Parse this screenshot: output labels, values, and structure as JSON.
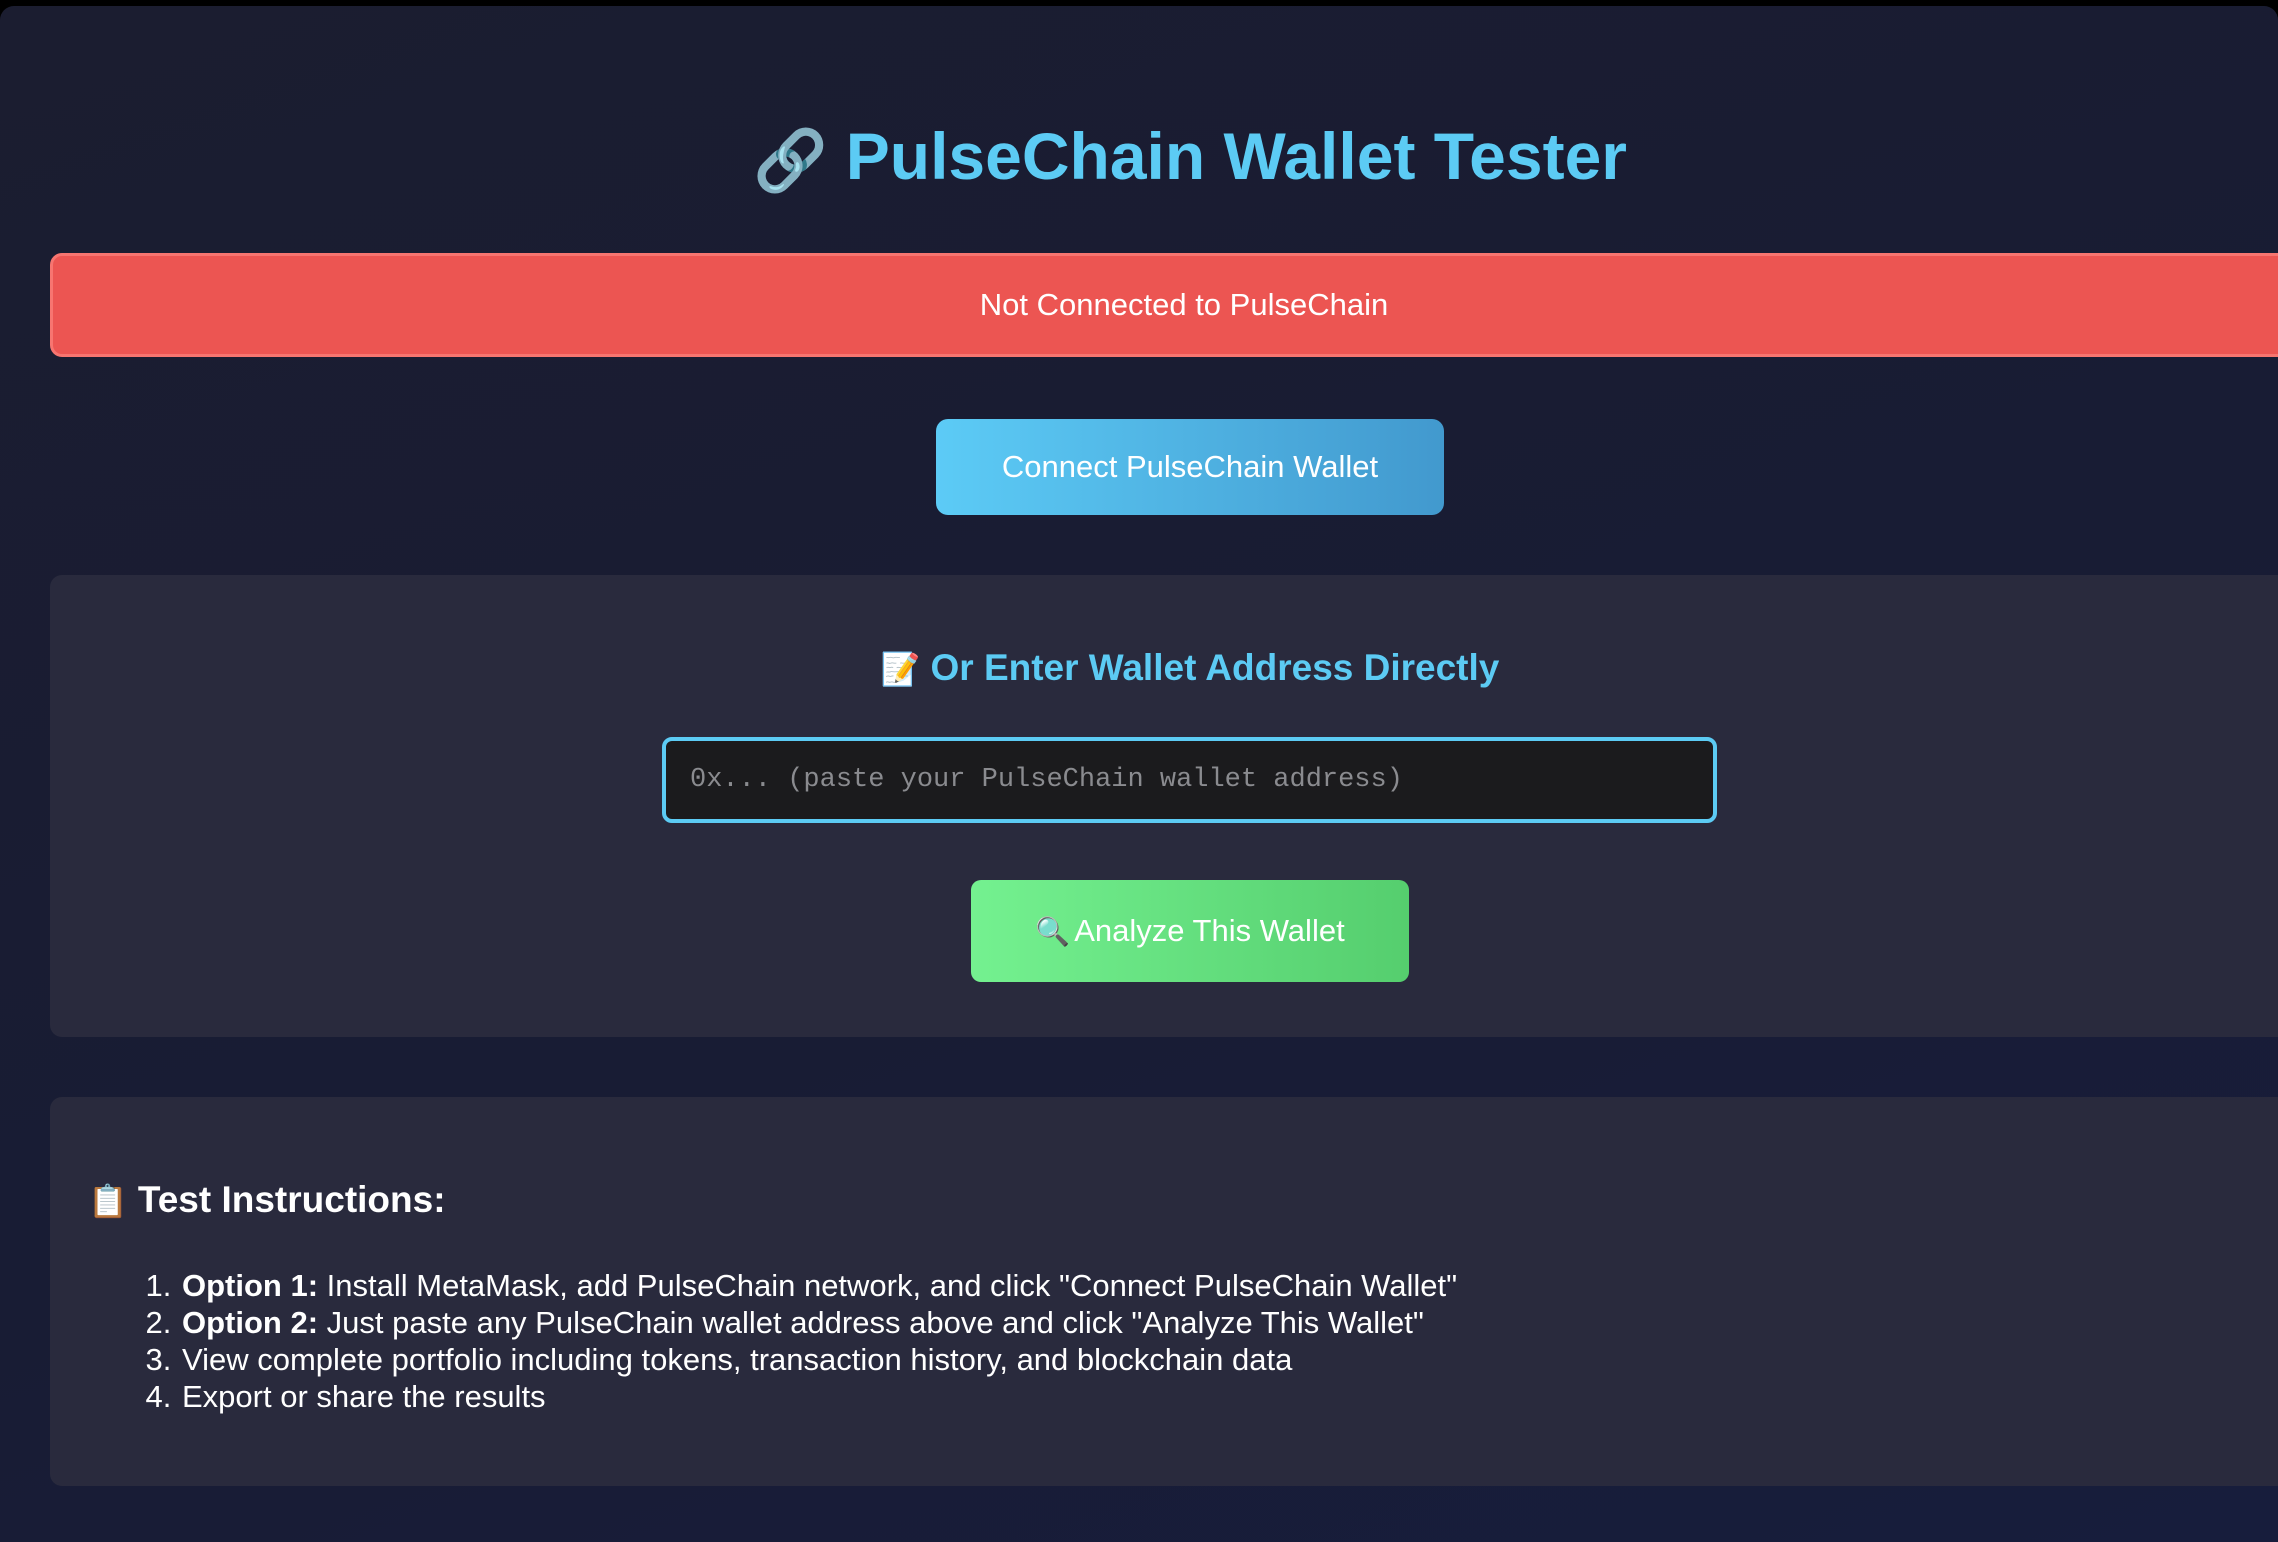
{
  "header": {
    "icon": "link-icon",
    "icon_glyph": "🔗",
    "title": "PulseChain Wallet Tester"
  },
  "status": {
    "text": "Not Connected to PulseChain",
    "color": "#ec5552"
  },
  "connect": {
    "label": "Connect PulseChain Wallet"
  },
  "manual": {
    "icon": "memo-icon",
    "icon_glyph": "📝",
    "heading": "Or Enter Wallet Address Directly",
    "input_placeholder": "0x... (paste your PulseChain wallet address)",
    "input_value": "",
    "analyze_icon": "magnifier-icon",
    "analyze_icon_glyph": "🔍",
    "analyze_label": "Analyze This Wallet"
  },
  "instructions": {
    "icon": "clipboard-icon",
    "icon_glyph": "📋",
    "heading": "Test Instructions:",
    "steps": [
      {
        "bold": "Option 1:",
        "text": " Install MetaMask, add PulseChain network, and click \"Connect PulseChain Wallet\""
      },
      {
        "bold": "Option 2:",
        "text": " Just paste any PulseChain wallet address above and click \"Analyze This Wallet\""
      },
      {
        "bold": "",
        "text": "View complete portfolio including tokens, transaction history, and blockchain data"
      },
      {
        "bold": "",
        "text": "Export or share the results"
      }
    ]
  },
  "colors": {
    "accent": "#5ccbf4",
    "error": "#ec5552",
    "success": "#6ee58a",
    "panel": "#292a3d"
  }
}
